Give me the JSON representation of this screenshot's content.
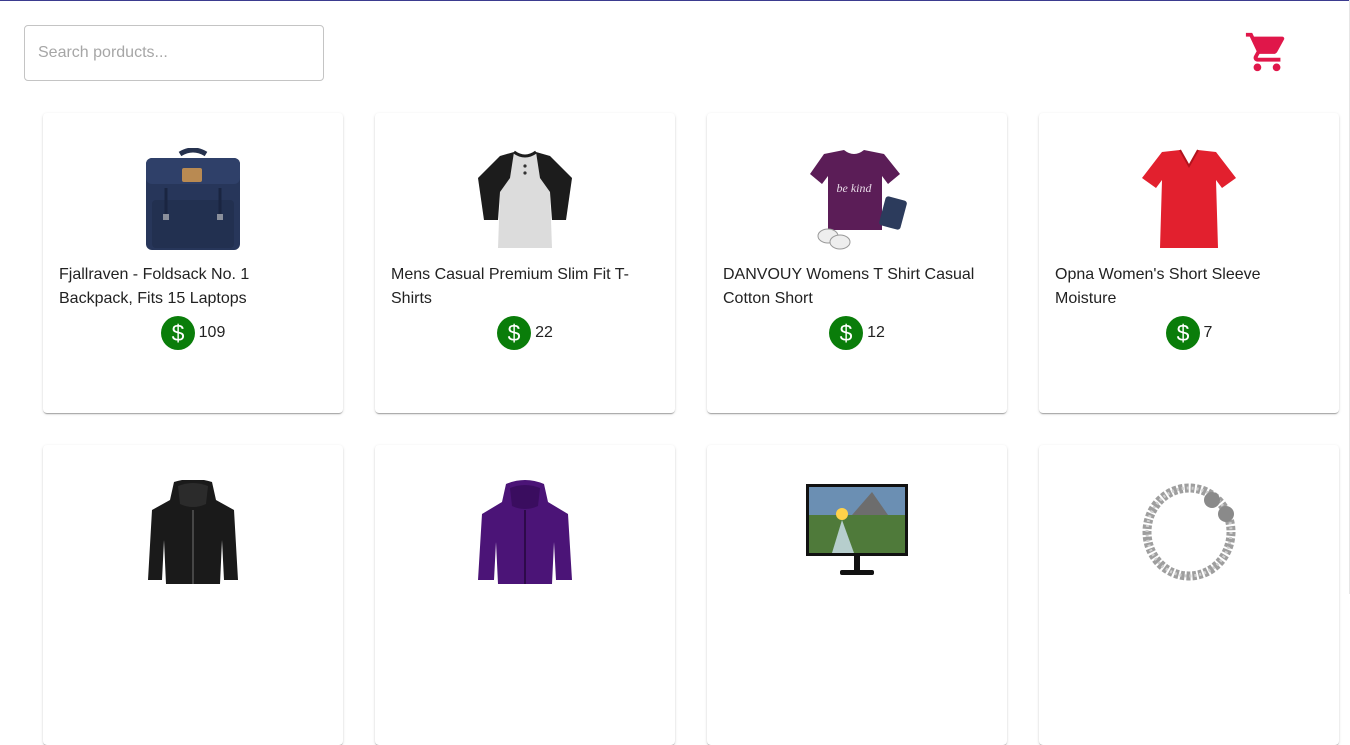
{
  "search": {
    "placeholder": "Search porducts..."
  },
  "header": {
    "cart_icon": "shopping-cart-icon",
    "cart_color": "#e0174a"
  },
  "price_icon_color": "#0a7d0a",
  "products": [
    {
      "title": "Fjallraven - Foldsack No. 1 Backpack, Fits 15 Laptops",
      "price": "109",
      "image": "backpack"
    },
    {
      "title": "Mens Casual Premium Slim Fit T-Shirts",
      "price": "22",
      "image": "raglan-shirt"
    },
    {
      "title": "DANVOUY Womens T Shirt Casual Cotton Short",
      "price": "12",
      "image": "purple-tshirt"
    },
    {
      "title": "Opna Women's Short Sleeve Moisture",
      "price": "7",
      "image": "red-vneck"
    },
    {
      "title": "",
      "price": "",
      "image": "leather-jacket"
    },
    {
      "title": "",
      "price": "",
      "image": "purple-jacket"
    },
    {
      "title": "",
      "price": "",
      "image": "monitor"
    },
    {
      "title": "",
      "price": "",
      "image": "chain-bracelet"
    }
  ]
}
